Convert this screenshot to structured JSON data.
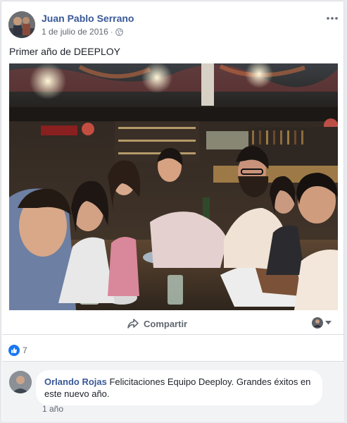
{
  "post": {
    "author": "Juan Pablo Serrano",
    "date": "1 de julio de 2016",
    "separator": "·",
    "text": "Primer año de DEEPLOY"
  },
  "actions": {
    "share_label": "Compartir"
  },
  "reactions": {
    "like_count": "7"
  },
  "comment": {
    "author": "Orlando Rojas",
    "text": "Felicitaciones Equipo Deeploy. Grandes éxitos en este nuevo año.",
    "time": "1 año"
  },
  "colors": {
    "link": "#385898",
    "like_blue": "#1877f2",
    "muted": "#616770"
  }
}
